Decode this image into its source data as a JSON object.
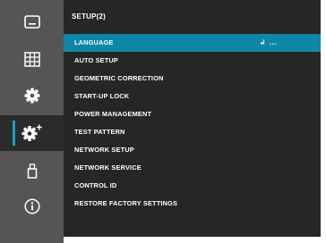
{
  "header": {
    "title": "SETUP(2)"
  },
  "sidebar": {
    "items": [
      {
        "icon": "picture-icon"
      },
      {
        "icon": "grid-icon"
      },
      {
        "icon": "gear-icon"
      },
      {
        "icon": "gear-plus-icon",
        "active": true
      },
      {
        "icon": "usb-icon"
      },
      {
        "icon": "info-icon"
      }
    ]
  },
  "menu": {
    "items": [
      {
        "label": "LANGUAGE",
        "selected": true,
        "hint_enter": "↲",
        "hint_more": "..."
      },
      {
        "label": "AUTO SETUP"
      },
      {
        "label": "GEOMETRIC CORRECTION"
      },
      {
        "label": "START-UP LOCK"
      },
      {
        "label": "POWER MANAGEMENT"
      },
      {
        "label": "TEST PATTERN"
      },
      {
        "label": "NETWORK SETUP"
      },
      {
        "label": "NETWORK SERVICE"
      },
      {
        "label": "CONTROL ID"
      },
      {
        "label": "RESTORE FACTORY SETTINGS"
      }
    ]
  },
  "colors": {
    "sidebar_bg": "#555555",
    "sidebar_active_bg": "#2b2b2b",
    "panel_bg": "#262626",
    "selection": "#0f86a8",
    "accent_bar": "#1aa0c6"
  }
}
